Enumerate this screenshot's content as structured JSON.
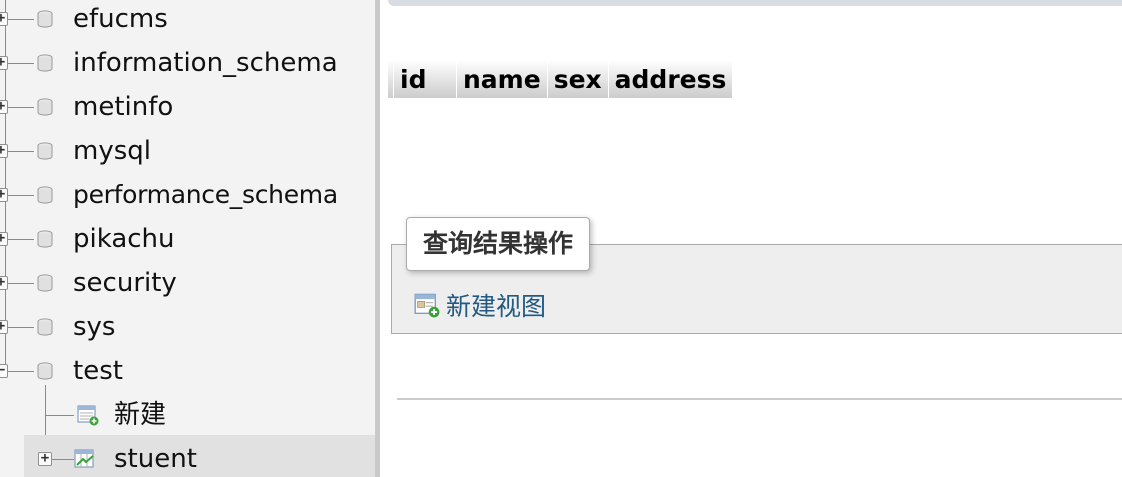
{
  "nav": {
    "databases": [
      {
        "name": "efucms",
        "expander": "+"
      },
      {
        "name": "information_schema",
        "expander": "+"
      },
      {
        "name": "metinfo",
        "expander": "+"
      },
      {
        "name": "mysql",
        "expander": "+"
      },
      {
        "name": "performance_schema",
        "expander": "+"
      },
      {
        "name": "pikachu",
        "expander": "+"
      },
      {
        "name": "security",
        "expander": "+"
      },
      {
        "name": "sys",
        "expander": "+"
      },
      {
        "name": "test",
        "expander": "−"
      }
    ],
    "test_children": [
      {
        "name": "新建",
        "icon": "new-table-icon"
      },
      {
        "name": "stuent",
        "icon": "table-icon",
        "expander": "+"
      }
    ]
  },
  "result": {
    "columns": [
      "id",
      "name",
      "sex",
      "address"
    ]
  },
  "operations": {
    "legend": "查询结果操作",
    "create_view": "新建视图"
  },
  "colors": {
    "link": "#235a81",
    "nav_bg": "#f3f3f3",
    "fieldset_bg": "#eeeeee"
  }
}
